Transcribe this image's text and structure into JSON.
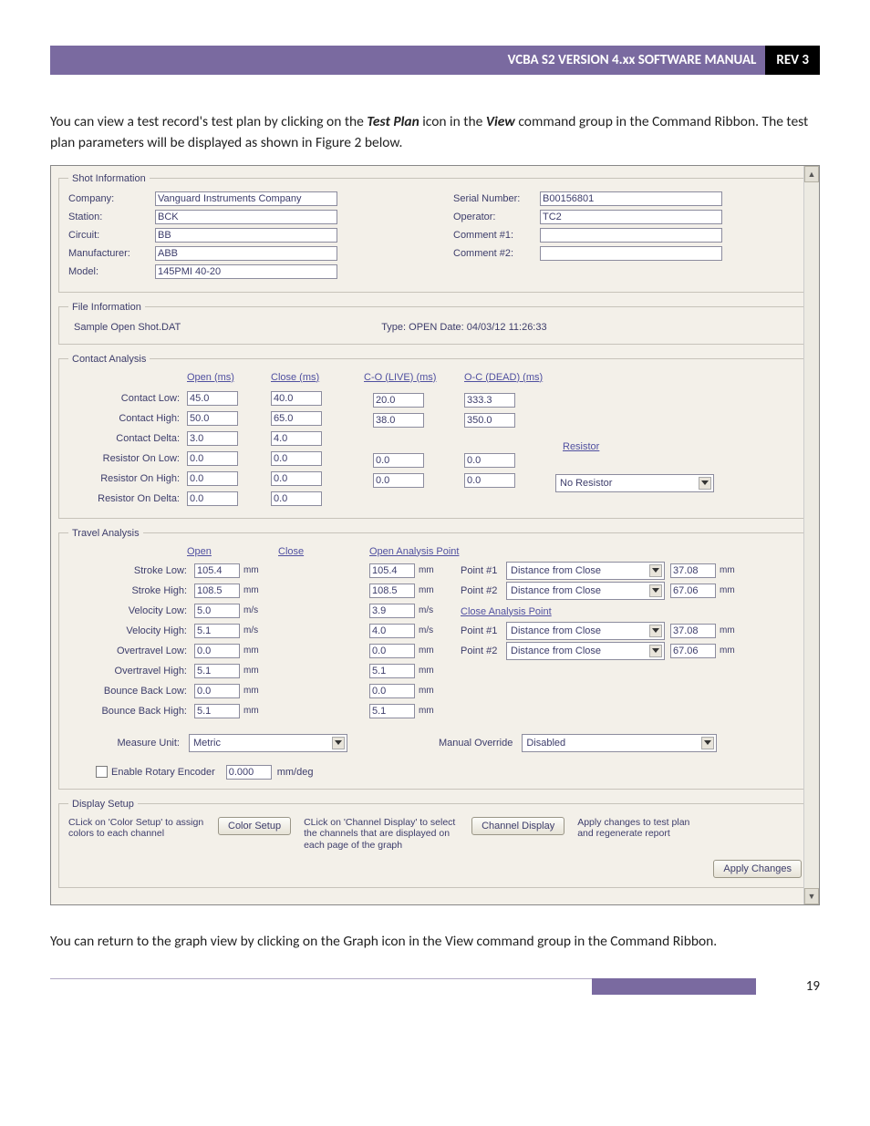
{
  "header": {
    "title": "VCBA S2 VERSION 4.xx SOFTWARE MANUAL",
    "rev": "REV 3"
  },
  "intro": {
    "p1a": "You can view a test record's test plan by clicking on the ",
    "p1b": "Test Plan",
    "p1c": " icon in the ",
    "p1d": "View",
    "p1e": " command group in the Command Ribbon. The test plan parameters will be displayed as shown in Figure 2 below."
  },
  "shot": {
    "legend": "Shot Information",
    "labels": {
      "company": "Company:",
      "station": "Station:",
      "circuit": "Circuit:",
      "manufacturer": "Manufacturer:",
      "model": "Model:",
      "serial": "Serial Number:",
      "operator": "Operator:",
      "comment1": "Comment #1:",
      "comment2": "Comment #2:"
    },
    "vals": {
      "company": "Vanguard Instruments Company",
      "station": "BCK",
      "circuit": "BB",
      "manufacturer": "ABB",
      "model": "145PMI 40-20",
      "serial": "B00156801",
      "operator": "TC2",
      "comment1": "",
      "comment2": ""
    }
  },
  "file": {
    "legend": "File Information",
    "name": "Sample Open Shot.DAT",
    "type_date": "Type: OPEN  Date: 04/03/12 11:26:33"
  },
  "contact": {
    "legend": "Contact Analysis",
    "heads": {
      "open": "Open (ms)",
      "close": "Close (ms)",
      "co_live": "C-O (LIVE) (ms)",
      "oc_dead": "O-C (DEAD) (ms)"
    },
    "rows": {
      "contact_low": "Contact Low:",
      "contact_high": "Contact High:",
      "contact_delta": "Contact Delta:",
      "res_low": "Resistor On Low:",
      "res_high": "Resistor On High:",
      "res_delta": "Resistor On Delta:"
    },
    "open": {
      "contact_low": "45.0",
      "contact_high": "50.0",
      "contact_delta": "3.0",
      "res_low": "0.0",
      "res_high": "0.0",
      "res_delta": "0.0"
    },
    "close": {
      "contact_low": "40.0",
      "contact_high": "65.0",
      "contact_delta": "4.0",
      "res_low": "0.0",
      "res_high": "0.0",
      "res_delta": "0.0"
    },
    "co": {
      "a": "20.0",
      "b": "38.0",
      "c": "0.0",
      "d": "0.0"
    },
    "oc": {
      "a": "333.3",
      "b": "350.0",
      "c": "0.0",
      "d": "0.0"
    },
    "resistor_lbl": "Resistor",
    "resistor_sel": "No Resistor"
  },
  "travel": {
    "legend": "Travel Analysis",
    "heads": {
      "open": "Open",
      "close": "Close",
      "oap": "Open Analysis Point",
      "cap": "Close Analysis Point"
    },
    "rows": {
      "stroke_low": "Stroke Low:",
      "stroke_high": "Stroke High:",
      "vel_low": "Velocity Low:",
      "vel_high": "Velocity High:",
      "ot_low": "Overtravel Low:",
      "ot_high": "Overtravel High:",
      "bb_low": "Bounce Back Low:",
      "bb_high": "Bounce Back High:"
    },
    "open": {
      "stroke_low": "105.4",
      "stroke_high": "108.5",
      "vel_low": "5.0",
      "vel_high": "5.1",
      "ot_low": "0.0",
      "ot_high": "5.1",
      "bb_low": "0.0",
      "bb_high": "5.1"
    },
    "close": {
      "stroke_low": "105.4",
      "stroke_high": "108.5",
      "vel_low": "3.9",
      "vel_high": "4.0",
      "ot_low": "0.0",
      "ot_high": "5.1",
      "bb_low": "0.0",
      "bb_high": "5.1"
    },
    "units": {
      "mm": "mm",
      "ms": "m/s"
    },
    "points": {
      "p1": "Point #1",
      "p2": "Point #2",
      "sel": "Distance from Close",
      "oap1": "37.08",
      "oap2": "67.06",
      "cap1": "37.08",
      "cap2": "67.06"
    },
    "measure_unit_lbl": "Measure Unit:",
    "measure_unit_sel": "Metric",
    "manual_ov_lbl": "Manual Override",
    "manual_ov_sel": "Disabled",
    "encoder_lbl": "Enable Rotary Encoder",
    "encoder_val": "0.000",
    "encoder_unit": "mm/deg"
  },
  "display": {
    "legend": "Display Setup",
    "color_note": "CLick on 'Color Setup' to assign colors to each channel",
    "color_btn": "Color Setup",
    "channel_note": "CLick on 'Channel Display' to select the channels that are displayed on each page of the graph",
    "channel_btn": "Channel Display",
    "apply_note": "Apply changes to test plan and regenerate report",
    "apply_btn": "Apply Changes"
  },
  "outro": {
    "a": "You can return to the graph view by clicking on the ",
    "b": "Graph",
    "c": " icon in the ",
    "d": "View",
    "e": " command group in the Command Ribbon."
  },
  "page_number": "19"
}
